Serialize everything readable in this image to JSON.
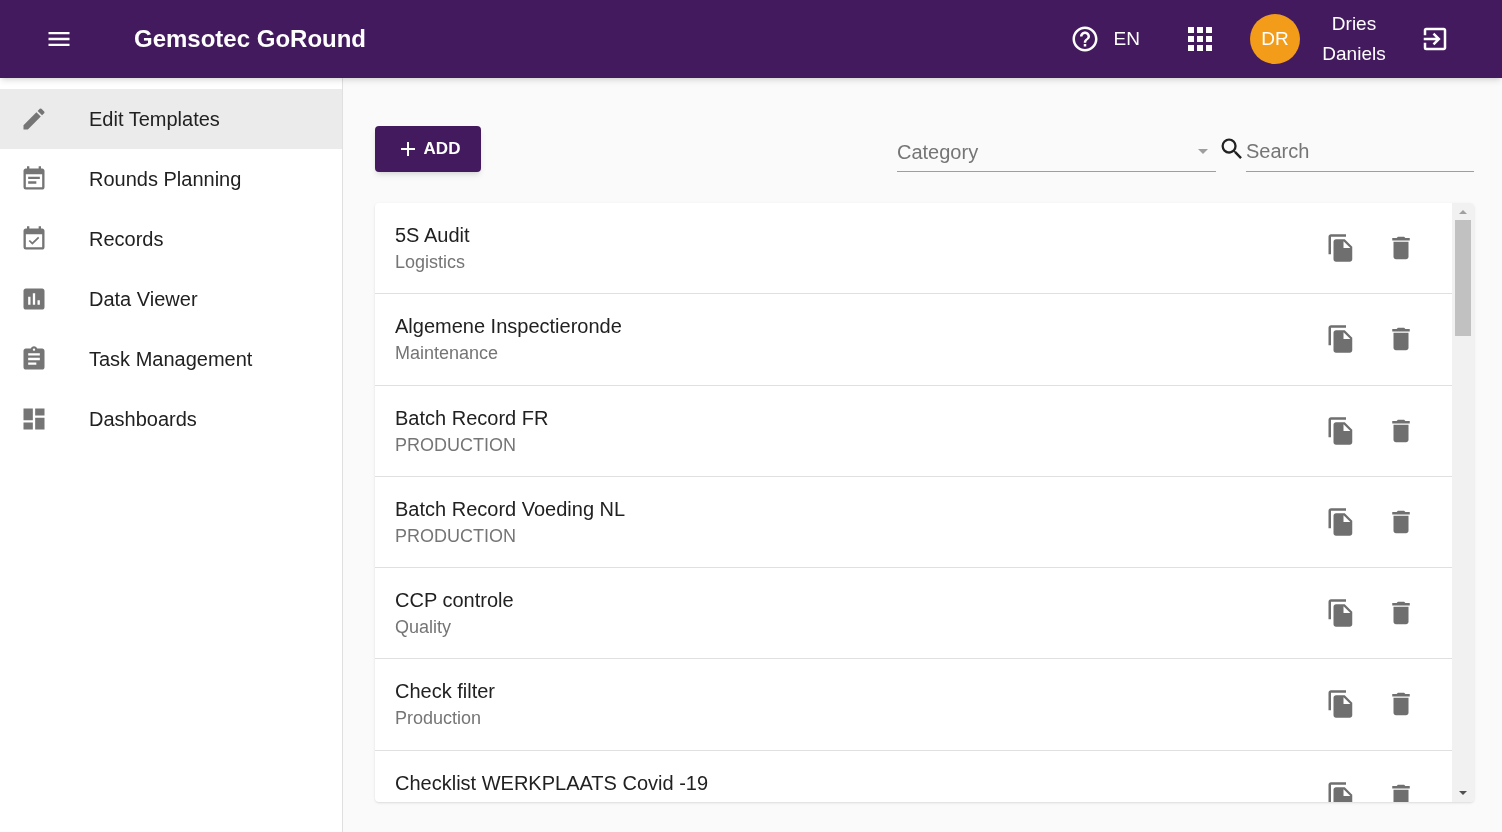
{
  "app_bar": {
    "title": "Gemsotec GoRound",
    "language": "EN",
    "avatar_initials": "DR",
    "user_name": "Dries Daniels"
  },
  "sidebar": {
    "items": [
      {
        "label": "Edit Templates",
        "kind": "edit",
        "selected": true
      },
      {
        "label": "Rounds Planning",
        "kind": "planning",
        "selected": false
      },
      {
        "label": "Records",
        "kind": "records",
        "selected": false
      },
      {
        "label": "Data Viewer",
        "kind": "chart",
        "selected": false
      },
      {
        "label": "Task Management",
        "kind": "tasks",
        "selected": false
      },
      {
        "label": "Dashboards",
        "kind": "dashboard",
        "selected": false
      }
    ]
  },
  "toolbar": {
    "add_button": "ADD",
    "category": {
      "placeholder": "Category"
    },
    "search": {
      "placeholder": "Search"
    }
  },
  "templates": [
    {
      "name": "5S Audit",
      "category": "Logistics"
    },
    {
      "name": "Algemene Inspectieronde",
      "category": "Maintenance"
    },
    {
      "name": "Batch Record FR",
      "category": "PRODUCTION"
    },
    {
      "name": "Batch Record Voeding NL",
      "category": "PRODUCTION"
    },
    {
      "name": "CCP controle",
      "category": "Quality"
    },
    {
      "name": "Check filter",
      "category": "Production"
    },
    {
      "name": "Checklist WERKPLAATS Covid -19"
    }
  ]
}
